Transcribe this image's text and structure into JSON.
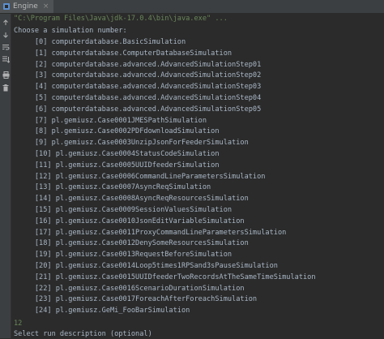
{
  "tab": {
    "label": "Engine",
    "close": "×"
  },
  "console": {
    "command": "\"C:\\Program Files\\Java\\jdk-17.0.4\\bin\\java.exe\" ...",
    "prompt": "Choose a simulation number:",
    "options": [
      "     [0] computerdatabase.BasicSimulation",
      "     [1] computerdatabase.ComputerDatabaseSimulation",
      "     [2] computerdatabase.advanced.AdvancedSimulationStep01",
      "     [3] computerdatabase.advanced.AdvancedSimulationStep02",
      "     [4] computerdatabase.advanced.AdvancedSimulationStep03",
      "     [5] computerdatabase.advanced.AdvancedSimulationStep04",
      "     [6] computerdatabase.advanced.AdvancedSimulationStep05",
      "     [7] pl.gemiusz.Case0001JMESPathSimulation",
      "     [8] pl.gemiusz.Case0002PDFdownloadSimulation",
      "     [9] pl.gemiusz.Case0003UnzipJsonForFeederSimulation",
      "     [10] pl.gemiusz.Case0004StatusCodeSimulation",
      "     [11] pl.gemiusz.Case0005UUIDfeederSimulation",
      "     [12] pl.gemiusz.Case0006CommandLineParametersSimulation",
      "     [13] pl.gemiusz.Case0007AsyncReqSimulation",
      "     [14] pl.gemiusz.Case0008AsyncReqResourcesSimulation",
      "     [15] pl.gemiusz.Case0009SessionValuesSimulation",
      "     [16] pl.gemiusz.Case0010JsonEditVariableSimulation",
      "     [17] pl.gemiusz.Case0011ProxyCommandLineParametersSimulation",
      "     [18] pl.gemiusz.Case0012DenySomeResourcesSimulation",
      "     [19] pl.gemiusz.Case0013RequestBeforeSimulation",
      "     [20] pl.gemiusz.Case0014Loop5times1RPSand3sPauseSimulation",
      "     [21] pl.gemiusz.Case0015UUIDfeederTwoRecordsAtTheSameTimeSimulation",
      "     [22] pl.gemiusz.Case0016ScenarioDurationSimulation",
      "     [23] pl.gemiusz.Case0017ForeachAfterForeachSimulation",
      "     [24] pl.gemiusz.GeMi_FooBarSimulation"
    ],
    "input": "12",
    "next_prompt": "Select run description (optional)"
  },
  "icons": {
    "tab": "java-run-icon",
    "gutter": [
      "rerun-up-icon",
      "rerun-down-icon",
      "soft-wrap-icon",
      "scroll-end-icon",
      "print-icon",
      "trash-icon"
    ]
  },
  "colors": {
    "background": "#2b2b2b",
    "text": "#a9b7c6",
    "input": "#6a8759"
  }
}
